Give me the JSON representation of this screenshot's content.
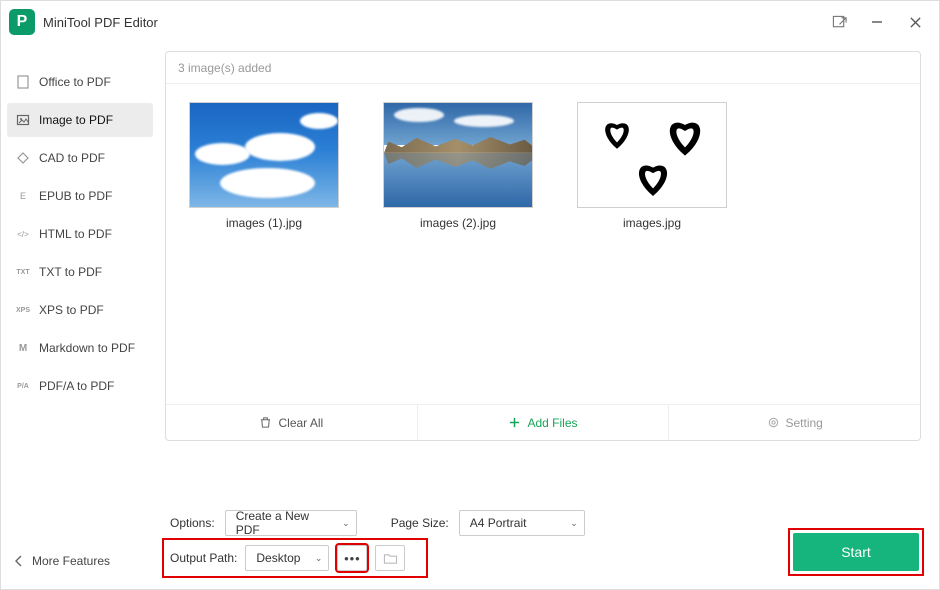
{
  "app": {
    "title": "MiniTool PDF Editor"
  },
  "sidebar": {
    "items": [
      {
        "label": "Office to PDF",
        "icon": "office-icon"
      },
      {
        "label": "Image to PDF",
        "icon": "image-icon"
      },
      {
        "label": "CAD to PDF",
        "icon": "cad-icon"
      },
      {
        "label": "EPUB to PDF",
        "icon": "epub-icon"
      },
      {
        "label": "HTML to PDF",
        "icon": "html-icon"
      },
      {
        "label": "TXT to PDF",
        "icon": "txt-icon"
      },
      {
        "label": "XPS to PDF",
        "icon": "xps-icon"
      },
      {
        "label": "Markdown to PDF",
        "icon": "markdown-icon"
      },
      {
        "label": "PDF/A to PDF",
        "icon": "pdfa-icon"
      }
    ],
    "activeIndex": 1
  },
  "panel": {
    "summary": "3 image(s) added",
    "files": [
      {
        "name": "images (1).jpg"
      },
      {
        "name": "images (2).jpg"
      },
      {
        "name": "images.jpg"
      }
    ],
    "actions": {
      "clear": "Clear All",
      "add": "Add Files",
      "setting": "Setting"
    }
  },
  "options": {
    "optionsLabel": "Options:",
    "optionsValue": "Create a New PDF",
    "pageSizeLabel": "Page Size:",
    "pageSizeValue": "A4 Portrait",
    "outputPathLabel": "Output Path:",
    "outputPathValue": "Desktop",
    "start": "Start",
    "moreFeatures": "More Features"
  },
  "colors": {
    "accent": "#16b57d",
    "highlight": "#e00000"
  }
}
